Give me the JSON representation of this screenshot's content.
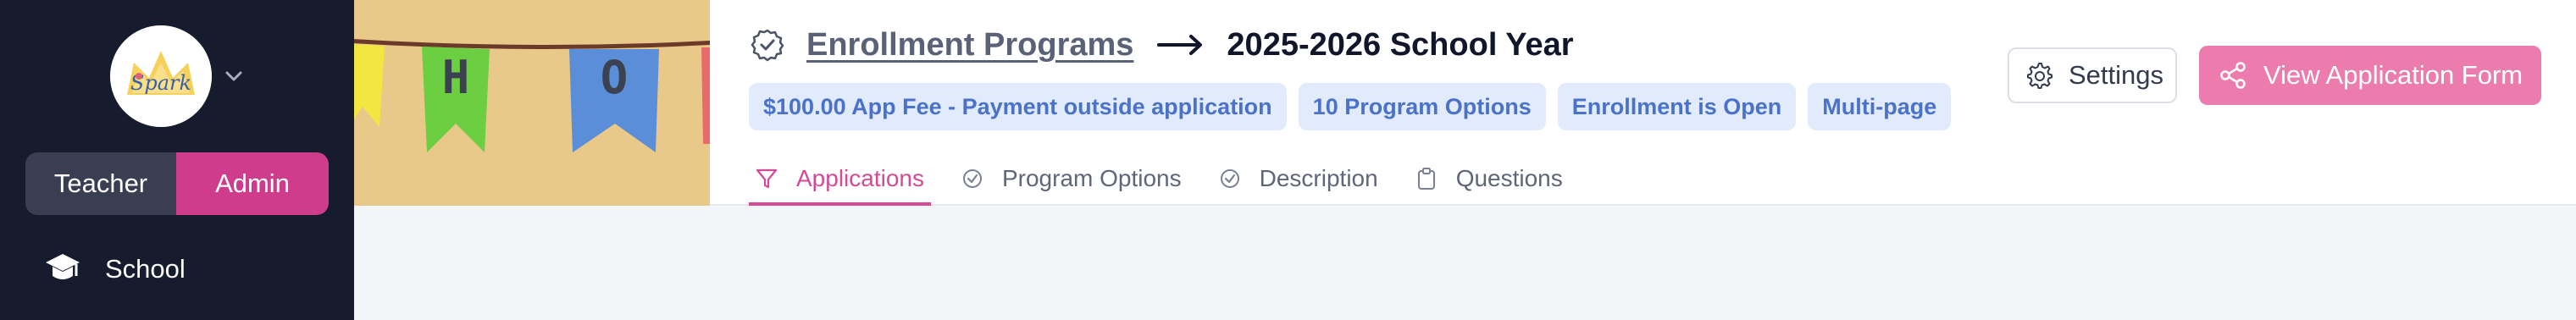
{
  "sidebar": {
    "logo_text": "Spark",
    "role_toggle": {
      "teacher_label": "Teacher",
      "admin_label": "Admin",
      "active": "Admin"
    },
    "nav": {
      "school_label": "School",
      "school_icon": "graduation-cap-icon"
    }
  },
  "banner": {
    "letters": [
      "H",
      "O"
    ]
  },
  "header": {
    "breadcrumb_link": "Enrollment Programs",
    "arrow": "→",
    "title": "2025-2026 School Year",
    "badges": [
      "$100.00 App Fee - Payment outside application",
      "10 Program Options",
      "Enrollment is Open",
      "Multi-page"
    ],
    "tabs": [
      {
        "label": "Applications",
        "icon": "filter-icon",
        "active": true
      },
      {
        "label": "Program Options",
        "icon": "check-circle-icon",
        "active": false
      },
      {
        "label": "Description",
        "icon": "check-circle-icon",
        "active": false
      },
      {
        "label": "Questions",
        "icon": "clipboard-icon",
        "active": false
      }
    ],
    "settings_label": "Settings",
    "view_form_label": "View Application Form"
  },
  "colors": {
    "sidebar_bg": "#161b2d",
    "accent_pink": "#ce3c8b",
    "button_pink": "#eb7cad",
    "badge_bg": "#e1ebfb",
    "badge_text": "#4b72c9"
  }
}
